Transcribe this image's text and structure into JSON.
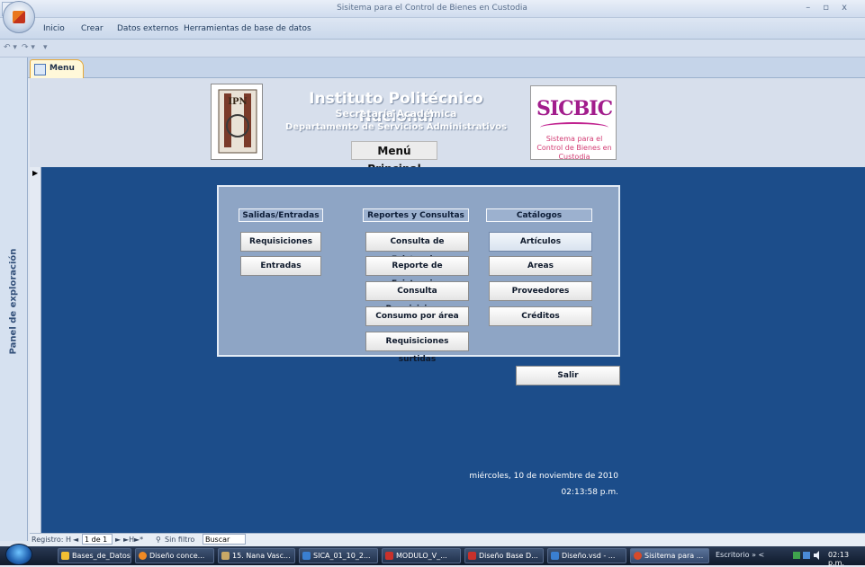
{
  "window": {
    "title": "Sisitema para el Control de Bienes en Custodia"
  },
  "ribbon": {
    "tabs": [
      "Inicio",
      "Crear",
      "Datos externos",
      "Herramientas de base de datos"
    ]
  },
  "nav_pane": {
    "toggle": "»",
    "label": "Panel de exploración"
  },
  "doc_tab": {
    "label": "Menu"
  },
  "header": {
    "institute": "Instituto Politécnico Nacional",
    "secretaria": "Secretaría Académica",
    "departamento": "Departamento de Servicios Administrativos",
    "menu_title": "Menú Principal",
    "logo_text": "SICBIC",
    "logo_sub": "Sistema para el Control de Bienes en Custodia",
    "ipn_logo_text": "IPN"
  },
  "menu": {
    "col1": {
      "header": "Salidas/Entradas",
      "buttons": [
        "Requisiciones",
        "Entradas"
      ]
    },
    "col2": {
      "header": "Reportes y Consultas",
      "buttons": [
        "Consulta de Existencias",
        "Reporte de Existencias",
        "Consulta Requisiciones",
        "Consumo por área",
        "Requisiciones surtidas"
      ]
    },
    "col3": {
      "header": "Catálogos",
      "buttons": [
        "Artículos",
        "Areas",
        "Proveedores",
        "Créditos"
      ]
    },
    "exit": "Salir"
  },
  "footer": {
    "date": "miércoles, 10 de noviembre de 2010",
    "time": "02:13:58 p.m."
  },
  "record_nav": {
    "label": "Registro:",
    "first": "H",
    "prev": "◄",
    "record": "1 de 1",
    "next": "►",
    "last": "►H",
    "new": "►*",
    "filter": "Sin filtro",
    "search": "Buscar"
  },
  "taskbar": {
    "items": [
      "Bases_de_Datos",
      "Diseño conce...",
      "15. Nana Vasc...",
      "SICA_01_10_2...",
      "MODULO_V_...",
      "Diseño Base D...",
      "Diseño.vsd - ...",
      "Sisitema para ..."
    ],
    "desktop": "Escritorio",
    "clock": "02:13 p.m."
  },
  "colors": {
    "form_background": "#1c4d8a",
    "panel": "#8ea5c5"
  }
}
